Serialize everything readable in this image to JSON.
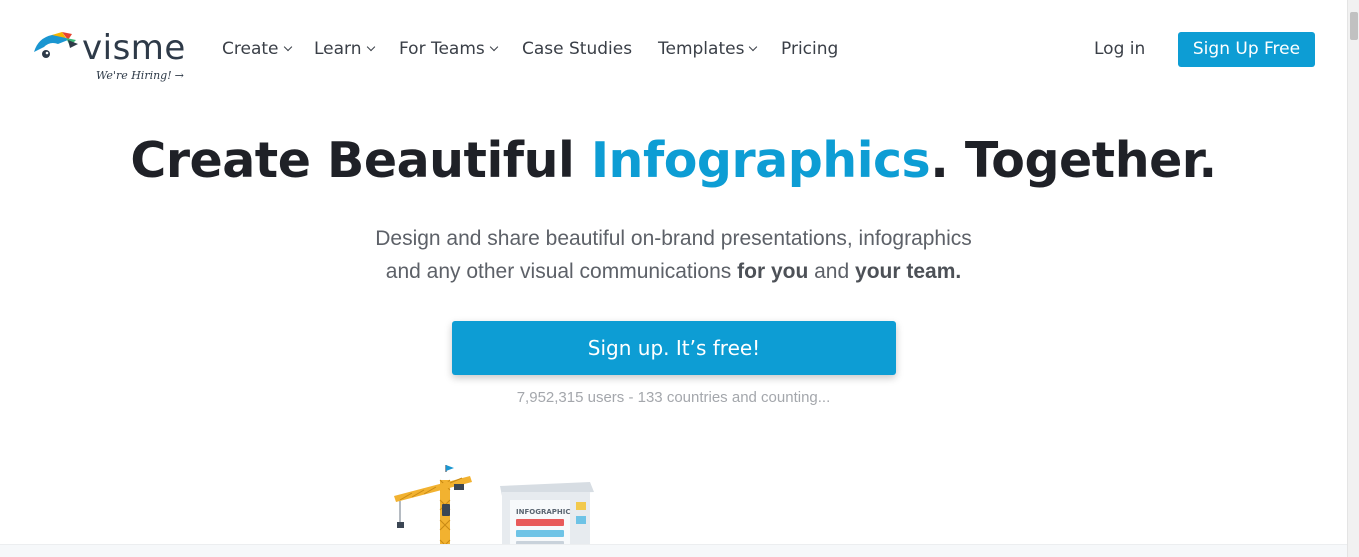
{
  "header": {
    "logo": {
      "word": "visme",
      "tagline": "We're Hiring!",
      "tagline_arrow": "→"
    },
    "nav": [
      {
        "label": "Create",
        "has_dropdown": true
      },
      {
        "label": "Learn",
        "has_dropdown": true
      },
      {
        "label": "For Teams",
        "has_dropdown": true
      },
      {
        "label": "Case Studies",
        "has_dropdown": false
      },
      {
        "label": "Templates",
        "has_dropdown": true
      },
      {
        "label": "Pricing",
        "has_dropdown": false
      }
    ],
    "login_label": "Log in",
    "signup_label": "Sign Up Free"
  },
  "hero": {
    "title_before": "Create Beautiful ",
    "title_accent": "Infographics",
    "title_after": ". Together.",
    "sub_line1": "Design and share beautiful on-brand presentations, infographics",
    "sub_line2_start": "and any other visual communications ",
    "sub_bold1": "for you",
    "sub_mid": " and ",
    "sub_bold2": "your team.",
    "cta_label": "Sign up. It’s free!",
    "stats": "7,952,315 users - 133 countries and counting..."
  },
  "illustration": {
    "box_label": "INFOGRAPHIC"
  },
  "colors": {
    "accent": "#0d9dd4",
    "heading": "#1f2127",
    "text": "#5d6168",
    "muted": "#a4a7ac"
  }
}
